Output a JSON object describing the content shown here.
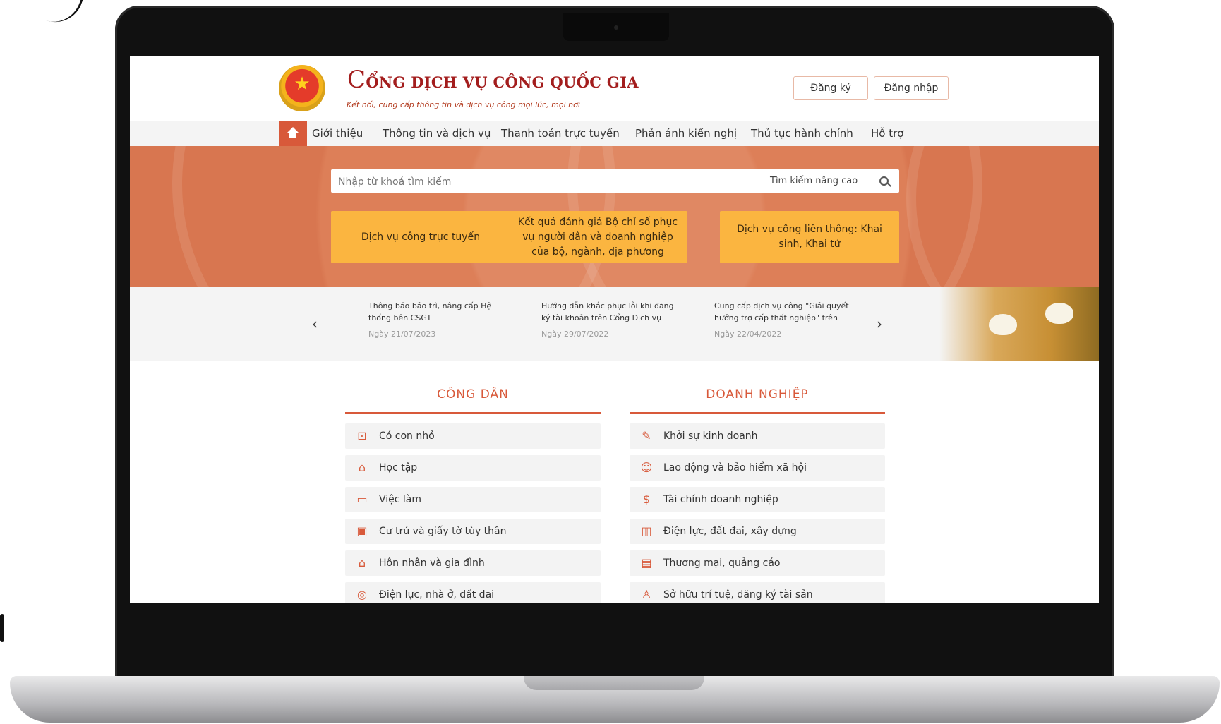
{
  "header": {
    "portal_title_initial": "C",
    "portal_title_rest": "ỔNG DỊCH VỤ CÔNG QUỐC GIA",
    "slogan": "Kết nối, cung cấp thông tin và dịch vụ công mọi lúc, mọi nơi",
    "register_label": "Đăng ký",
    "login_label": "Đăng nhập"
  },
  "nav": {
    "items": [
      "Giới thiệu",
      "Thông tin và dịch vụ",
      "Thanh toán trực tuyến",
      "Phản ánh kiến nghị",
      "Thủ tục hành chính",
      "Hỗ trợ"
    ]
  },
  "search": {
    "placeholder": "Nhập từ khoá tìm kiếm",
    "advanced_label": "Tìm kiếm nâng cao"
  },
  "features": [
    "Dịch vụ công trực tuyến",
    "Kết quả đánh giá Bộ chỉ số phục vụ người dân và doanh nghiệp của bộ, ngành, địa phương",
    "Dịch vụ công liên thông: Khai sinh, Khai tử"
  ],
  "news": [
    {
      "title": "Thông báo bảo trì, nâng cấp Hệ thống bên CSGT",
      "date": "Ngày 21/07/2023"
    },
    {
      "title": "Hướng dẫn khắc phục lỗi khi đăng ký tài khoản trên Cổng Dịch vụ công quốc gia",
      "date": "Ngày 29/07/2022"
    },
    {
      "title": "Cung cấp dịch vụ công \"Giải quyết hưởng trợ cấp thất nghiệp\" trên Cổng...",
      "date": "Ngày 22/04/2022"
    }
  ],
  "citizen": {
    "title": "CÔNG DÂN",
    "items": [
      "Có con nhỏ",
      "Học tập",
      "Việc làm",
      "Cư trú và giấy tờ tùy thân",
      "Hôn nhân và gia đình",
      "Điện lực, nhà ở, đất đai"
    ]
  },
  "business": {
    "title": "DOANH NGHIỆP",
    "items": [
      "Khởi sự kinh doanh",
      "Lao động và bảo hiểm xã hội",
      "Tài chính doanh nghiệp",
      "Điện lực, đất đai, xây dựng",
      "Thương mại, quảng cáo",
      "Sở hữu trí tuệ, đăng ký tài sản"
    ]
  },
  "colors": {
    "accent": "#d8593a",
    "feature_button": "#fbb540",
    "title_red": "#a31d1d"
  }
}
